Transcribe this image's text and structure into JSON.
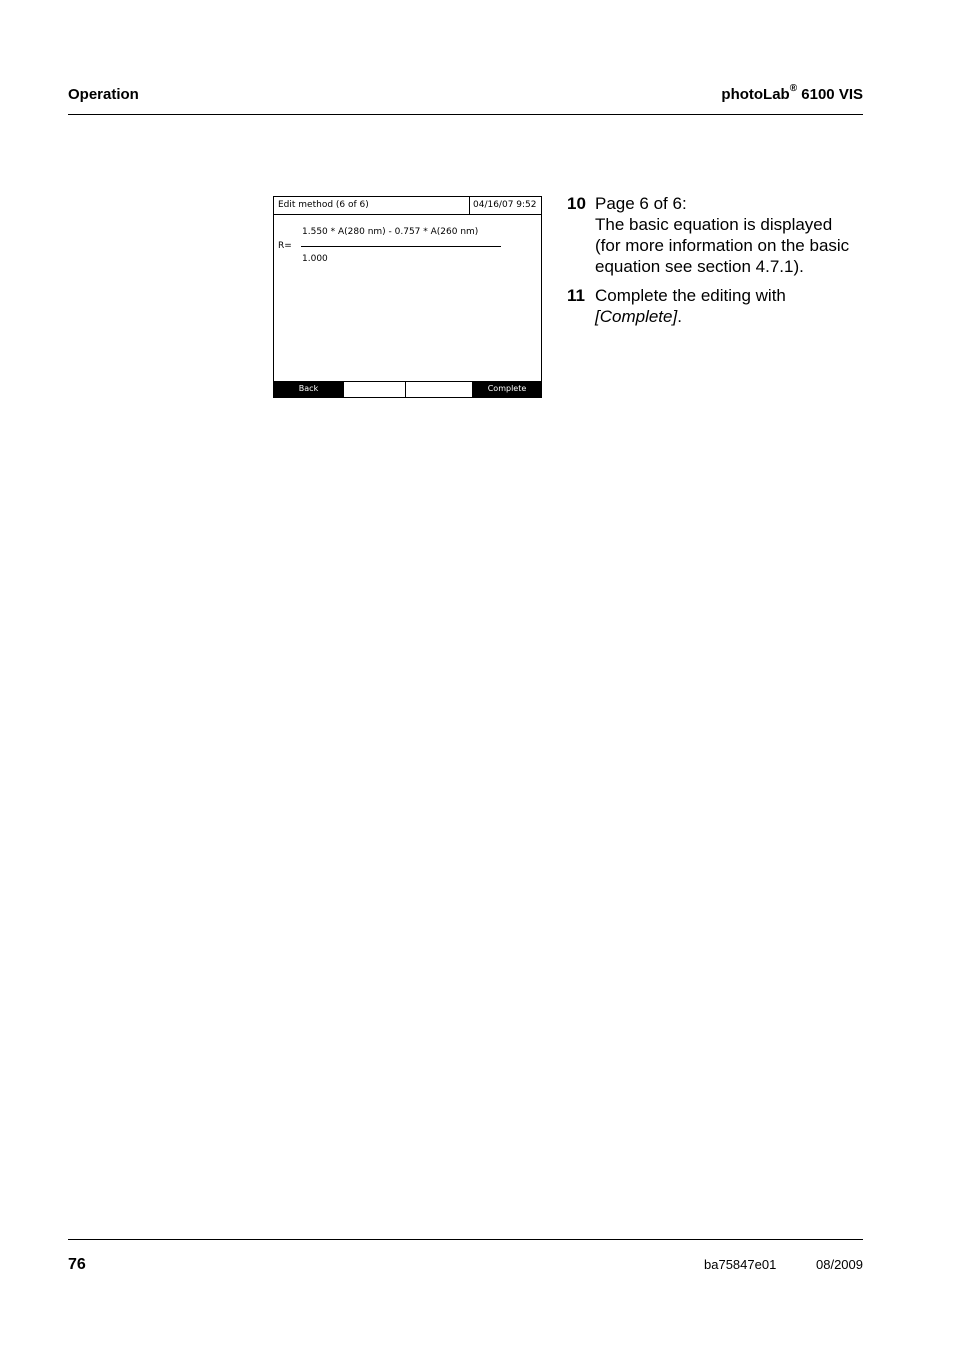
{
  "header": {
    "section": "Operation",
    "product_name": "photoLab",
    "product_mark": "®",
    "product_model": "6100 VIS"
  },
  "screen": {
    "title": "Edit method (6 of 6)",
    "datetime": "04/16/07  9:52",
    "result_label": "R=",
    "numerator": "1.550 * A(280 nm) - 0.757 * A(260 nm)",
    "denominator": "1.000",
    "softkeys": [
      "Back",
      "",
      "",
      "Complete"
    ]
  },
  "steps": [
    {
      "number": "10",
      "lines": [
        "Page 6 of 6:",
        "The basic equation is displayed",
        "(for more information on the basic",
        "equation see section 4.7.1)."
      ]
    },
    {
      "number": "11",
      "text": "Complete the editing with",
      "action": "[Complete]",
      "suffix": "."
    }
  ],
  "footer": {
    "page_number": "76",
    "doc_id": "ba75847e01",
    "date": "08/2009"
  }
}
